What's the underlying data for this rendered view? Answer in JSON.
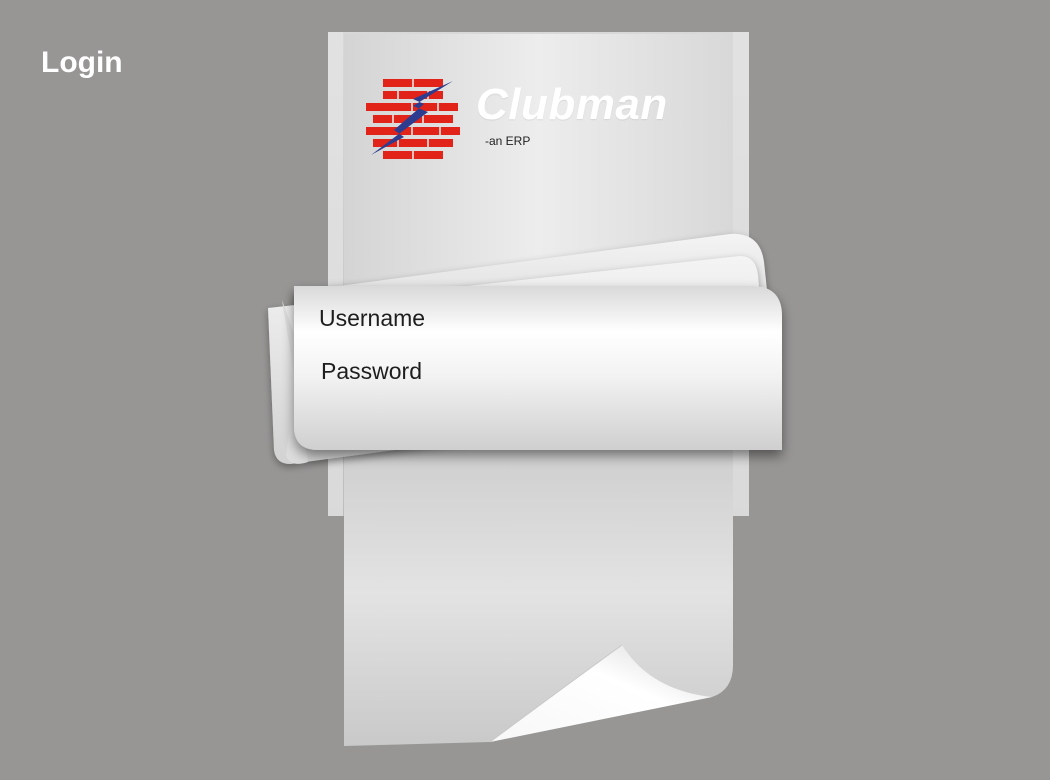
{
  "page": {
    "title": "Login"
  },
  "brand": {
    "name": "Clubman",
    "tagline": "-an ERP",
    "logo_icon": "brick-lightning-logo",
    "colors": {
      "bricks": "#e2231a",
      "bolt": "#2e3c8f"
    }
  },
  "form": {
    "username_label": "Username",
    "password_label": "Password",
    "username_value": "",
    "password_value": ""
  },
  "colors": {
    "background": "#979695",
    "paper": "#e8e8e8"
  }
}
